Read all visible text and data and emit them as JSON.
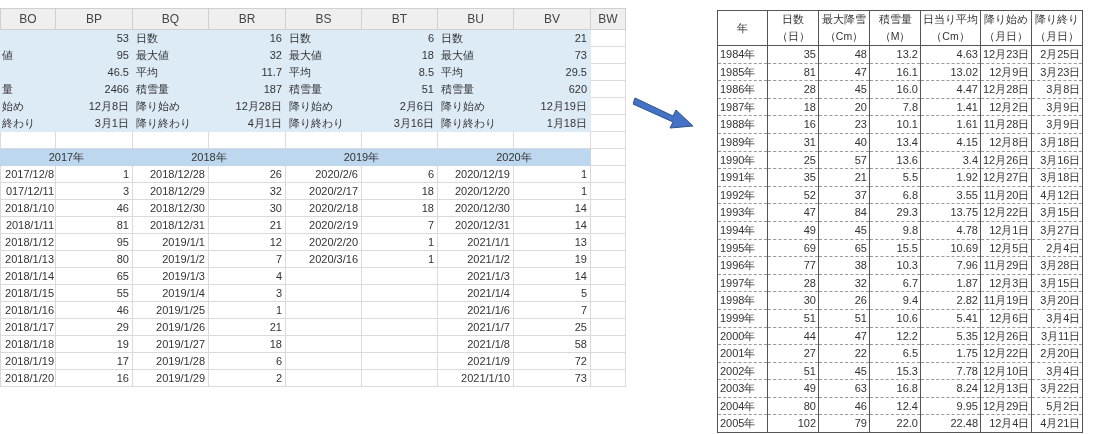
{
  "sheet": {
    "column_headers": [
      "BO",
      "BP",
      "BQ",
      "BR",
      "BS",
      "BT",
      "BU",
      "BV",
      "BW"
    ],
    "summary_rows": [
      {
        "values": [
          "53",
          "16",
          "6",
          "21"
        ],
        "labels": [
          "日数",
          "日数",
          "日数"
        ]
      },
      {
        "cut_label": "値",
        "values": [
          "95",
          "32",
          "18",
          "73"
        ],
        "labels": [
          "最大値",
          "最大値",
          "最大値"
        ]
      },
      {
        "values": [
          "46.5",
          "11.7",
          "8.5",
          "29.5"
        ],
        "labels": [
          "平均",
          "平均",
          "平均"
        ]
      },
      {
        "cut_label": "量",
        "values": [
          "2466",
          "187",
          "51",
          "620"
        ],
        "labels": [
          "積雪量",
          "積雪量",
          "積雪量"
        ]
      },
      {
        "cut_label": "始め",
        "values": [
          "12月8日",
          "12月28日",
          "2月6日",
          "12月19日"
        ],
        "labels": [
          "降り始め",
          "降り始め",
          "降り始め"
        ]
      },
      {
        "cut_label": "終わり",
        "values": [
          "3月1日",
          "4月1日",
          "3月16日",
          "1月18日"
        ],
        "labels": [
          "降り終わり",
          "降り終わり",
          "降り終わり"
        ]
      }
    ],
    "seasons": [
      {
        "year": "2017年",
        "dates": [
          "2017/12/8",
          "017/12/11",
          "2018/1/10",
          "2018/1/11",
          "2018/1/12",
          "2018/1/13",
          "2018/1/14",
          "2018/1/15",
          "2018/1/16",
          "2018/1/17",
          "2018/1/18",
          "2018/1/19",
          "2018/1/20"
        ],
        "counts": [
          "1",
          "3",
          "46",
          "81",
          "95",
          "80",
          "65",
          "55",
          "46",
          "29",
          "19",
          "17",
          "16"
        ]
      },
      {
        "year": "2018年",
        "dates": [
          "2018/12/28",
          "2018/12/29",
          "2018/12/30",
          "2018/12/31",
          "2019/1/1",
          "2019/1/2",
          "2019/1/3",
          "2019/1/4",
          "2019/1/25",
          "2019/1/26",
          "2019/1/27",
          "2019/1/28",
          "2019/1/29"
        ],
        "counts": [
          "26",
          "32",
          "30",
          "21",
          "12",
          "7",
          "4",
          "3",
          "1",
          "21",
          "18",
          "6",
          "2"
        ]
      },
      {
        "year": "2019年",
        "dates": [
          "2020/2/6",
          "2020/2/17",
          "2020/2/18",
          "2020/2/19",
          "2020/2/20",
          "2020/3/16"
        ],
        "counts": [
          "6",
          "18",
          "18",
          "7",
          "1",
          "1"
        ]
      },
      {
        "year": "2020年",
        "dates": [
          "2020/12/19",
          "2020/12/20",
          "2020/12/30",
          "2020/12/31",
          "2021/1/1",
          "2021/1/2",
          "2021/1/3",
          "2021/1/4",
          "2021/1/6",
          "2021/1/7",
          "2021/1/8",
          "2021/1/9",
          "2021/1/10"
        ],
        "counts": [
          "1",
          "1",
          "14",
          "14",
          "13",
          "19",
          "14",
          "5",
          "7",
          "25",
          "58",
          "72",
          "73"
        ]
      }
    ]
  },
  "table": {
    "columns": [
      {
        "title": "年"
      },
      {
        "title": "日数",
        "unit": "（日）"
      },
      {
        "title": "最大降雪",
        "unit": "（Cm）"
      },
      {
        "title": "積雪量",
        "unit": "（M）"
      },
      {
        "title": "日当り平均",
        "unit": "（Cm）"
      },
      {
        "title": "降り始め",
        "unit": "（月日）"
      },
      {
        "title": "降り終り",
        "unit": "（月日）"
      }
    ],
    "rows": [
      [
        "1984年",
        "35",
        "48",
        "13.2",
        "4.63",
        "12月23日",
        "2月25日"
      ],
      [
        "1985年",
        "81",
        "47",
        "16.1",
        "13.02",
        "12月9日",
        "3月23日"
      ],
      [
        "1986年",
        "28",
        "45",
        "16.0",
        "4.47",
        "12月28日",
        "3月8日"
      ],
      [
        "1987年",
        "18",
        "20",
        "7.8",
        "1.41",
        "12月2日",
        "3月9日"
      ],
      [
        "1988年",
        "16",
        "23",
        "10.1",
        "1.61",
        "11月28日",
        "3月9日"
      ],
      [
        "1989年",
        "31",
        "40",
        "13.4",
        "4.15",
        "12月8日",
        "3月18日"
      ],
      [
        "1990年",
        "25",
        "57",
        "13.6",
        "3.4",
        "12月26日",
        "3月16日"
      ],
      [
        "1991年",
        "35",
        "21",
        "5.5",
        "1.92",
        "12月27日",
        "3月18日"
      ],
      [
        "1992年",
        "52",
        "37",
        "6.8",
        "3.55",
        "11月20日",
        "4月12日"
      ],
      [
        "1993年",
        "47",
        "84",
        "29.3",
        "13.75",
        "12月22日",
        "3月15日"
      ],
      [
        "1994年",
        "49",
        "45",
        "9.8",
        "4.78",
        "12月1日",
        "3月27日"
      ],
      [
        "1995年",
        "69",
        "65",
        "15.5",
        "10.69",
        "12月5日",
        "2月4日"
      ],
      [
        "1996年",
        "77",
        "38",
        "10.3",
        "7.96",
        "11月29日",
        "3月28日"
      ],
      [
        "1997年",
        "28",
        "32",
        "6.7",
        "1.87",
        "12月3日",
        "3月15日"
      ],
      [
        "1998年",
        "30",
        "26",
        "9.4",
        "2.82",
        "11月19日",
        "3月20日"
      ],
      [
        "1999年",
        "51",
        "51",
        "10.6",
        "5.41",
        "12月6日",
        "3月4日"
      ],
      [
        "2000年",
        "44",
        "47",
        "12.2",
        "5.35",
        "12月26日",
        "3月11日"
      ],
      [
        "2001年",
        "27",
        "22",
        "6.5",
        "1.75",
        "12月22日",
        "2月20日"
      ],
      [
        "2002年",
        "51",
        "45",
        "15.3",
        "7.78",
        "12月10日",
        "3月4日"
      ],
      [
        "2003年",
        "49",
        "63",
        "16.8",
        "8.24",
        "12月13日",
        "3月22日"
      ],
      [
        "2004年",
        "80",
        "46",
        "12.4",
        "9.95",
        "12月29日",
        "5月2日"
      ],
      [
        "2005年",
        "102",
        "79",
        "22.0",
        "22.48",
        "12月4日",
        "4月21日"
      ]
    ]
  }
}
